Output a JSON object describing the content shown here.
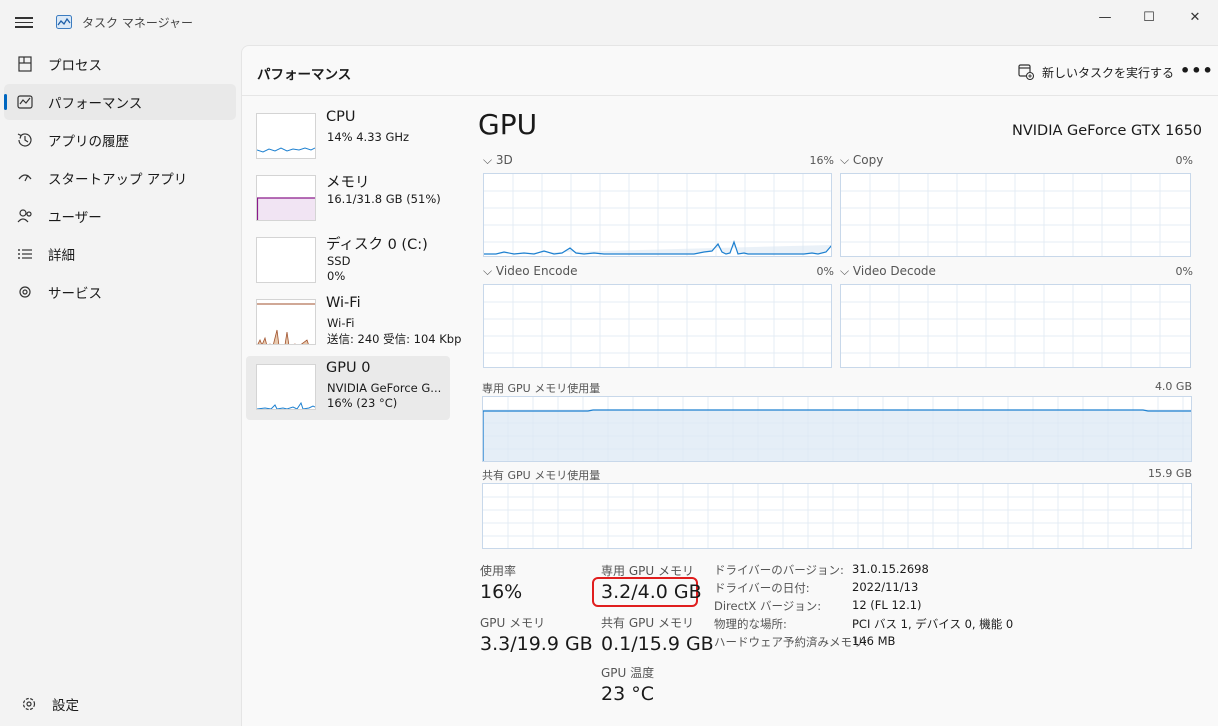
{
  "window": {
    "title": "タスク マネージャー",
    "minimize": "—",
    "maximize": "☐",
    "close": "✕"
  },
  "nav": {
    "items": [
      {
        "label": "プロセス",
        "icon": "processes-icon"
      },
      {
        "label": "パフォーマンス",
        "icon": "performance-icon",
        "active": true
      },
      {
        "label": "アプリの履歴",
        "icon": "app-history-icon"
      },
      {
        "label": "スタートアップ アプリ",
        "icon": "startup-icon"
      },
      {
        "label": "ユーザー",
        "icon": "users-icon"
      },
      {
        "label": "詳細",
        "icon": "details-icon"
      },
      {
        "label": "サービス",
        "icon": "services-icon"
      }
    ],
    "settings": "設定"
  },
  "header": {
    "title": "パフォーマンス",
    "run_task": "新しいタスクを実行する",
    "more": "•••"
  },
  "devices": [
    {
      "name": "CPU",
      "line1": "14%  4.33 GHz",
      "line2": ""
    },
    {
      "name": "メモリ",
      "line1": "16.1/31.8 GB (51%)",
      "line2": ""
    },
    {
      "name": "ディスク 0 (C:)",
      "line1": "SSD",
      "line2": "0%"
    },
    {
      "name": "Wi-Fi",
      "line1": "Wi-Fi",
      "line2": "送信: 240  受信: 104 Kbp"
    },
    {
      "name": "GPU 0",
      "line1": "NVIDIA GeForce G...",
      "line2": "16%  (23 °C)"
    }
  ],
  "gpu": {
    "title": "GPU",
    "model": "NVIDIA GeForce GTX 1650",
    "engines": [
      {
        "label": "3D",
        "percent": "16%"
      },
      {
        "label": "Copy",
        "percent": "0%"
      },
      {
        "label": "Video Encode",
        "percent": "0%"
      },
      {
        "label": "Video Decode",
        "percent": "0%"
      }
    ],
    "dedicated_graph": {
      "label": "専用 GPU メモリ使用量",
      "max": "4.0 GB"
    },
    "shared_graph": {
      "label": "共有 GPU メモリ使用量",
      "max": "15.9 GB"
    },
    "stats": {
      "usage_label": "使用率",
      "usage_value": "16%",
      "gpu_mem_label": "GPU メモリ",
      "gpu_mem_value": "3.3/19.9 GB",
      "dedicated_label": "専用 GPU メモリ",
      "dedicated_value": "3.2/4.0 GB",
      "shared_label": "共有 GPU メモリ",
      "shared_value": "0.1/15.9 GB",
      "temp_label": "GPU 温度",
      "temp_value": "23 °C"
    },
    "details": [
      {
        "key": "ドライバーのバージョン:",
        "value": "31.0.15.2698"
      },
      {
        "key": "ドライバーの日付:",
        "value": "2022/11/13"
      },
      {
        "key": "DirectX バージョン:",
        "value": "12 (FL 12.1)"
      },
      {
        "key": "物理的な場所:",
        "value": "PCI バス 1, デバイス 0, 機能 0"
      },
      {
        "key": "ハードウェア予約済みメモリ:",
        "value": "146 MB"
      }
    ]
  },
  "colors": {
    "accent": "#0067c0",
    "gpu_line": "#1d80d0",
    "memory_line": "#8b1a8b",
    "wifi_line": "#a0522d",
    "highlight": "#e01e1e"
  }
}
